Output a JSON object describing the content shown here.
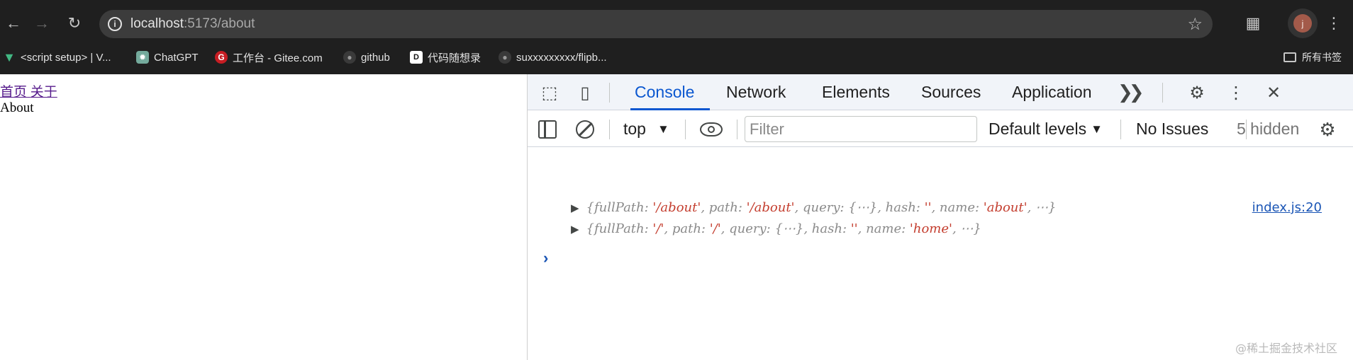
{
  "browser": {
    "url_host": "localhost",
    "url_path": ":5173/about",
    "profile_initial": "j",
    "bookmarks": [
      {
        "label": "<script setup> | V...",
        "icon": "vue-icon"
      },
      {
        "label": "ChatGPT",
        "icon": "chatgpt-icon"
      },
      {
        "label": "工作台 - Gitee.com",
        "icon": "gitee-icon"
      },
      {
        "label": "github",
        "icon": "github-icon"
      },
      {
        "label": "代码随想录",
        "icon": "dm-icon"
      },
      {
        "label": "suxxxxxxxxx/flipb...",
        "icon": "github-icon"
      }
    ],
    "all_bookmarks_label": "所有书签"
  },
  "page": {
    "nav_home": "首页",
    "nav_about": "关于",
    "content": "About"
  },
  "devtools": {
    "tabs": [
      "Console",
      "Network",
      "Elements",
      "Sources",
      "Application"
    ],
    "active_tab": "Console",
    "console_bar": {
      "context": "top",
      "filter_placeholder": "Filter",
      "levels": "Default levels",
      "issues": "No Issues",
      "hidden": "5 hidden"
    },
    "log": [
      {
        "parts": [
          "{fullPath: ",
          "'/about'",
          ", path: ",
          "'/about'",
          ", query: {⋯}, hash: ",
          "''",
          ", name: ",
          "'about'",
          ",  ⋯}"
        ],
        "source": "index.js:20"
      },
      {
        "parts": [
          "{fullPath: ",
          "'/'",
          ", path: ",
          "'/'",
          ", query: {⋯}, hash: ",
          "''",
          ", name: ",
          "'home'",
          ",  ⋯}"
        ],
        "source": ""
      }
    ]
  },
  "watermark": "@稀土掘金技术社区"
}
